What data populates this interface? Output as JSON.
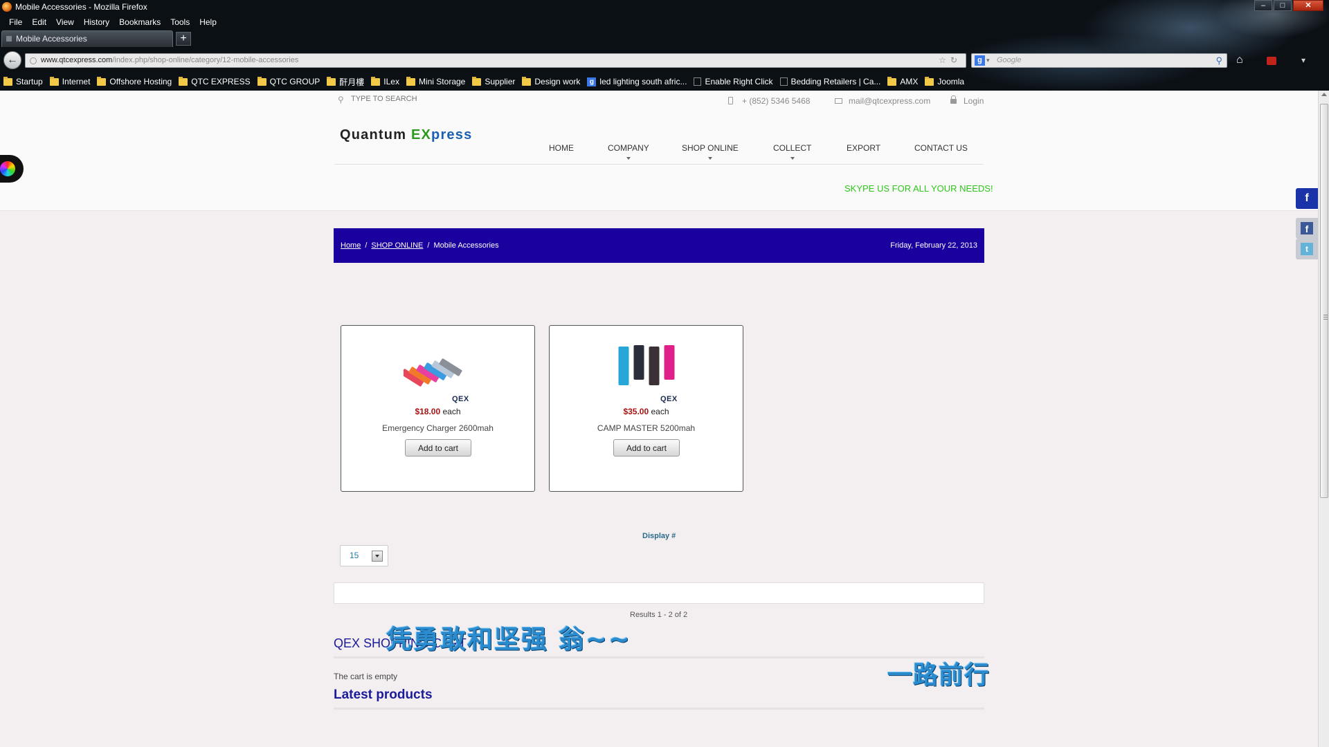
{
  "browser": {
    "window_title": "Mobile Accessories - Mozilla Firefox",
    "menu": [
      "File",
      "Edit",
      "View",
      "History",
      "Bookmarks",
      "Tools",
      "Help"
    ],
    "tab_title": "Mobile Accessories",
    "new_tab_label": "+",
    "url_host": "www.qtcexpress.com",
    "url_path": "/index.php/shop-online/category/12-mobile-accessories",
    "search_placeholder": "Google",
    "search_engine_icon": "g",
    "bookmarks": [
      {
        "label": "Startup",
        "icon": "folder"
      },
      {
        "label": "Internet",
        "icon": "folder"
      },
      {
        "label": "Offshore Hosting",
        "icon": "folder"
      },
      {
        "label": "QTC EXPRESS",
        "icon": "folder"
      },
      {
        "label": "QTC GROUP",
        "icon": "folder"
      },
      {
        "label": "酐月樓",
        "icon": "folder"
      },
      {
        "label": "ILex",
        "icon": "folder"
      },
      {
        "label": "Mini Storage",
        "icon": "folder"
      },
      {
        "label": "Supplier",
        "icon": "folder"
      },
      {
        "label": "Design work",
        "icon": "folder"
      },
      {
        "label": "led lighting south afric...",
        "icon": "google"
      },
      {
        "label": "Enable Right Click",
        "icon": "page"
      },
      {
        "label": "Bedding Retailers | Ca...",
        "icon": "page"
      },
      {
        "label": "AMX",
        "icon": "folder"
      },
      {
        "label": "Joomla",
        "icon": "folder"
      }
    ]
  },
  "site": {
    "search_placeholder": "TYPE TO SEARCH",
    "phone": "+ (852) 5346 5468",
    "email": "mail@qtcexpress.com",
    "login": "Login",
    "logo": {
      "part1": "Quantum ",
      "part2": "EX",
      "part3": "press"
    },
    "nav": [
      {
        "label": "HOME",
        "has_submenu": false
      },
      {
        "label": "COMPANY",
        "has_submenu": true
      },
      {
        "label": "SHOP ONLINE",
        "has_submenu": true
      },
      {
        "label": "COLLECT",
        "has_submenu": true
      },
      {
        "label": "EXPORT",
        "has_submenu": false
      },
      {
        "label": "CONTACT US",
        "has_submenu": false
      }
    ],
    "skype_text": "SKYPE US FOR ALL YOUR NEEDS!",
    "side_icons": [
      "f",
      "f",
      "t"
    ]
  },
  "breadcrumb": {
    "items": [
      "Home",
      "SHOP ONLINE"
    ],
    "current": "Mobile Accessories",
    "separator": "/",
    "date": "Friday, February 22, 2013"
  },
  "products": [
    {
      "brand": "QEX",
      "price": "$18.00",
      "unit": "each",
      "name": "Emergency Charger 2600mah",
      "button": "Add to cart",
      "swatches": [
        "#e8465a",
        "#f07a2a",
        "#e83fa0",
        "#3a9be0",
        "#b9c8d8",
        "#8a8f98"
      ]
    },
    {
      "brand": "QEX",
      "price": "$35.00",
      "unit": "each",
      "name": "CAMP MASTER 5200mah",
      "button": "Add to cart",
      "swatches": [
        "#27a7d8",
        "#2a2d3a",
        "#3a3036",
        "#e0208a"
      ]
    }
  ],
  "listing": {
    "display_label": "Display #",
    "limit_value": "15",
    "results_text": "Results 1 - 2 of 2"
  },
  "modules": {
    "cart_title": "QEX SHOPPING CART",
    "cart_empty": "The cart is empty",
    "latest_title": "Latest products"
  },
  "overlay": {
    "line1": "凭勇敢和坚强 翁~~",
    "line2": "一路前行"
  },
  "colors": {
    "breadcrumb_bg": "#1a009f",
    "skype_green": "#2ec61c",
    "price_red": "#a81414",
    "module_title": "#1a1a9a"
  }
}
